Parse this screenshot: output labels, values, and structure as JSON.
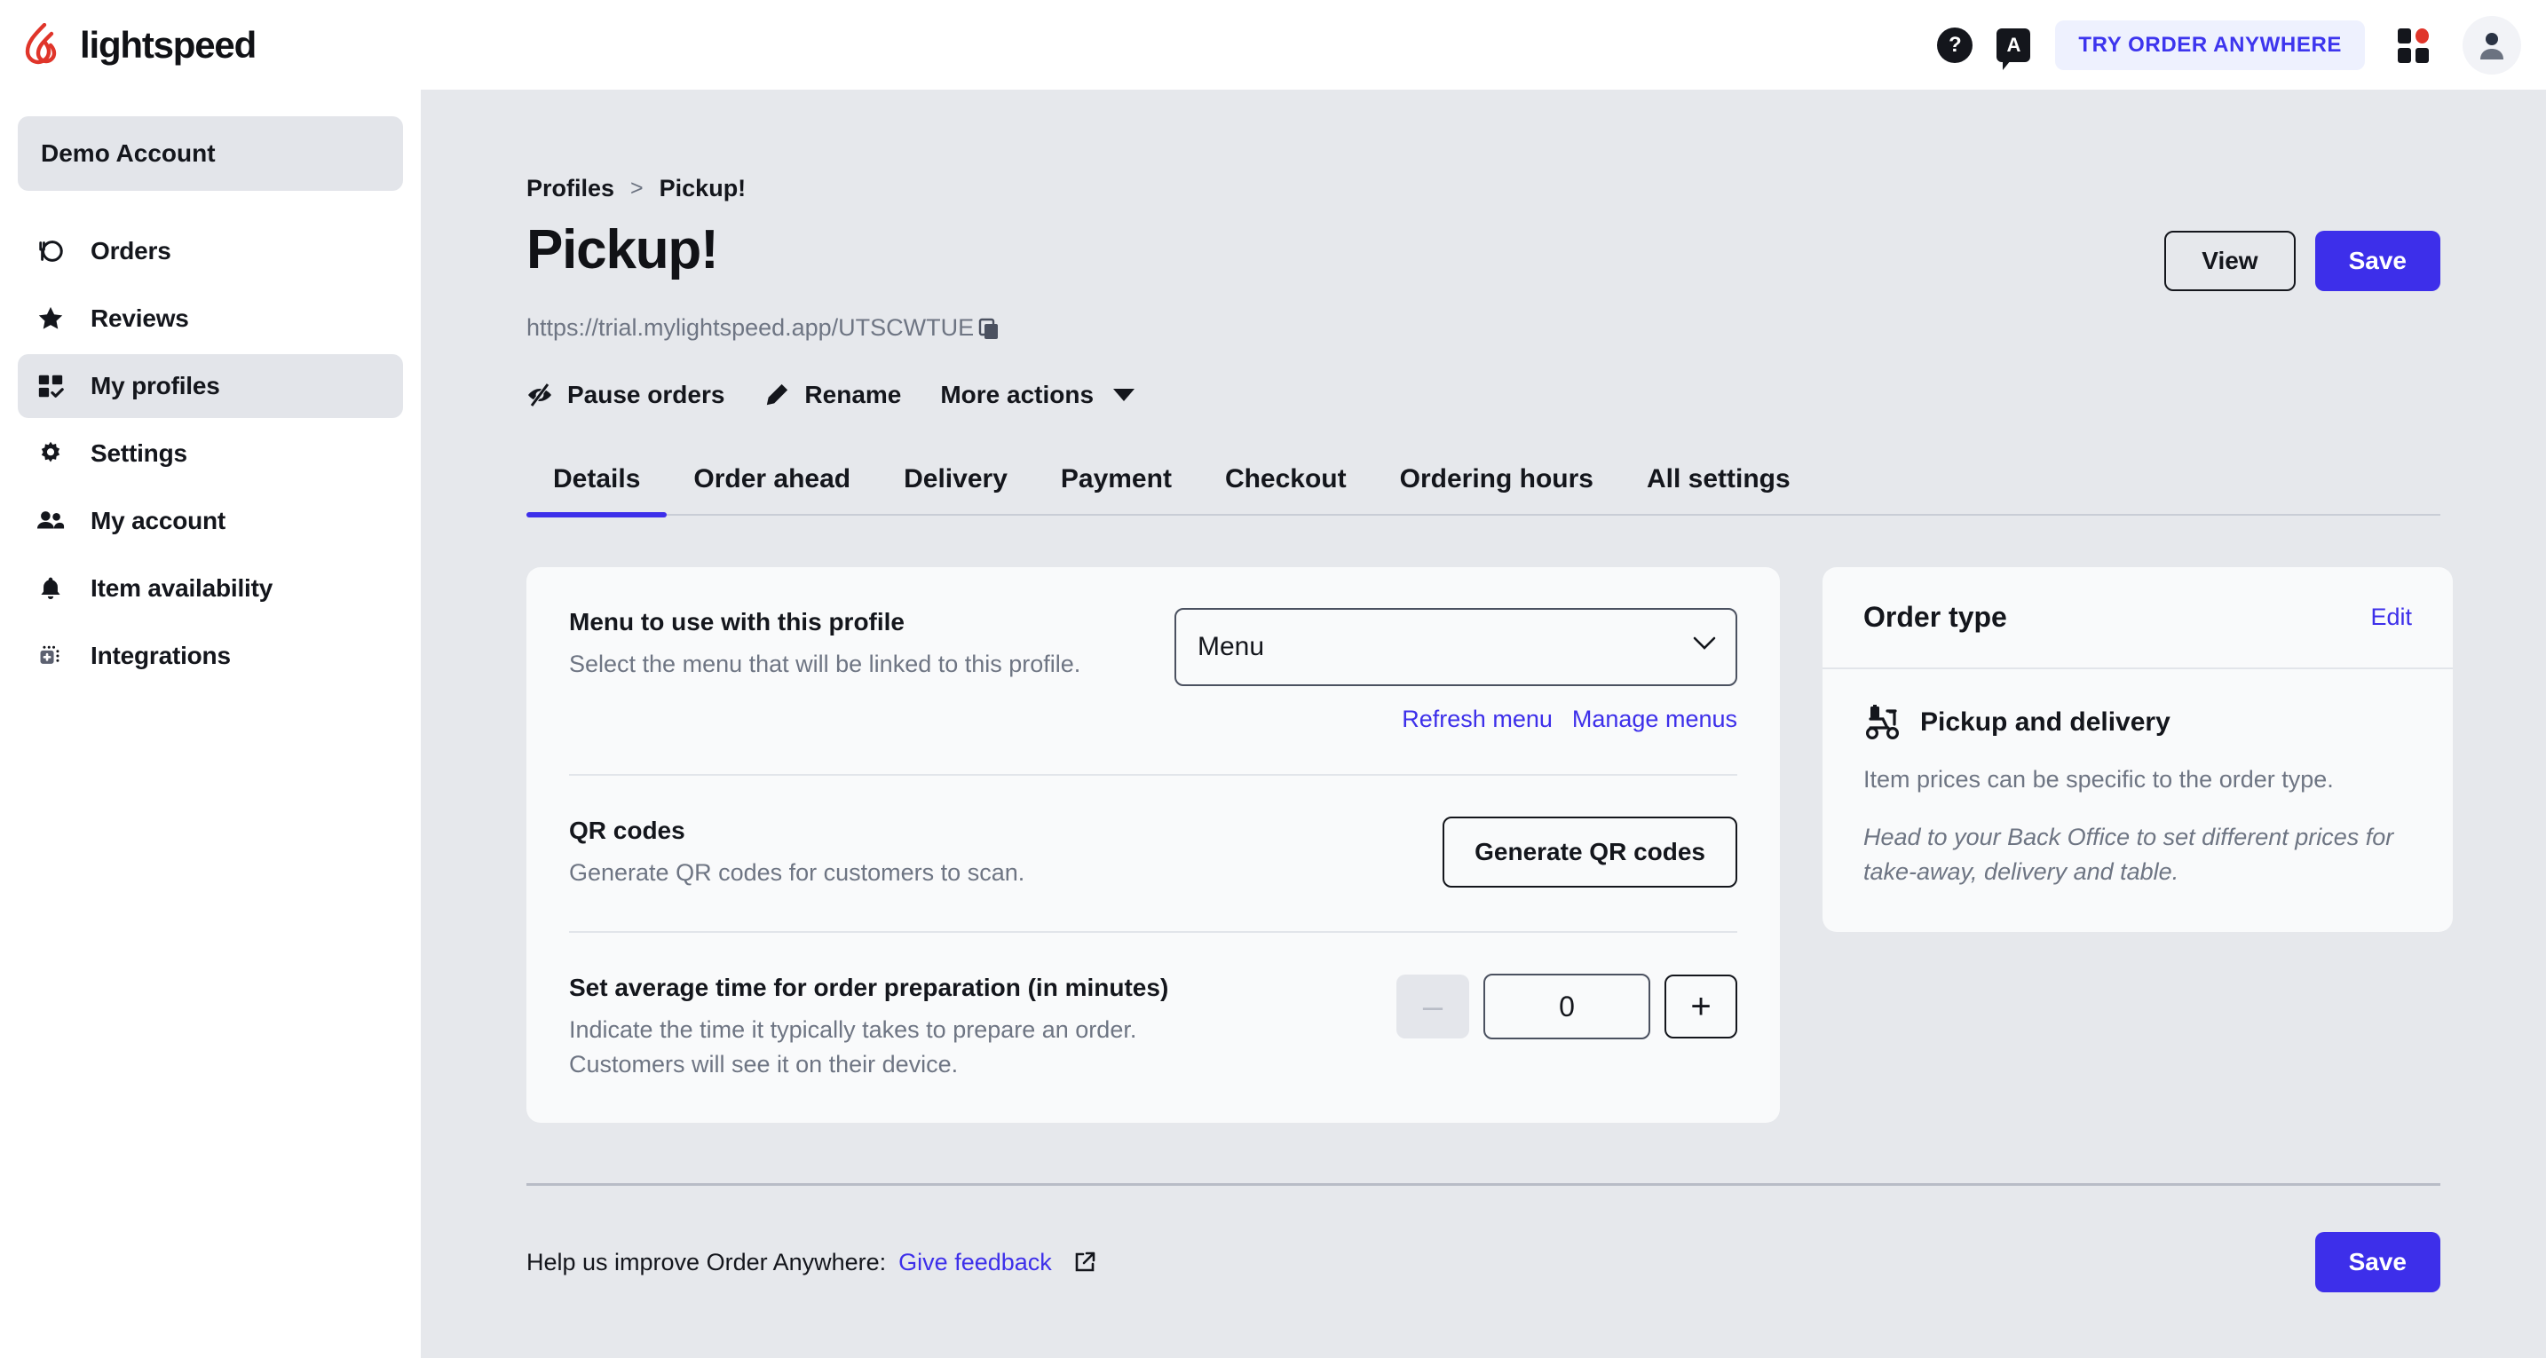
{
  "topbar": {
    "brand_name": "lightspeed",
    "brand_color": "#e0352a",
    "help_glyph": "?",
    "chat_glyph": "A",
    "try_button_label": "TRY ORDER ANYWHERE",
    "try_button_color": "#3d35ee"
  },
  "sidebar": {
    "account_label": "Demo Account",
    "items": [
      {
        "label": "Orders",
        "icon": "orders-icon",
        "active": false
      },
      {
        "label": "Reviews",
        "icon": "star-icon",
        "active": false
      },
      {
        "label": "My profiles",
        "icon": "profiles-grid-icon",
        "active": true
      },
      {
        "label": "Settings",
        "icon": "gear-icon",
        "active": false
      },
      {
        "label": "My account",
        "icon": "users-icon",
        "active": false
      },
      {
        "label": "Item availability",
        "icon": "bell-icon",
        "active": false
      },
      {
        "label": "Integrations",
        "icon": "integrations-icon",
        "active": false
      }
    ]
  },
  "breadcrumb": {
    "parent": "Profiles",
    "separator": ">",
    "current": "Pickup!"
  },
  "header": {
    "title": "Pickup!",
    "url": "https://trial.mylightspeed.app/UTSCWTUE",
    "view_label": "View",
    "save_label": "Save"
  },
  "actions": {
    "pause_orders": "Pause orders",
    "rename": "Rename",
    "more_actions": "More actions"
  },
  "tabs": [
    {
      "label": "Details",
      "active": true
    },
    {
      "label": "Order ahead",
      "active": false
    },
    {
      "label": "Delivery",
      "active": false
    },
    {
      "label": "Payment",
      "active": false
    },
    {
      "label": "Checkout",
      "active": false
    },
    {
      "label": "Ordering hours",
      "active": false
    },
    {
      "label": "All settings",
      "active": false
    }
  ],
  "details": {
    "menu_section": {
      "title": "Menu to use with this profile",
      "subtitle": "Select the menu that will be linked to this profile.",
      "selected_menu": "Menu",
      "refresh_link": "Refresh menu",
      "manage_link": "Manage menus"
    },
    "qr_section": {
      "title": "QR codes",
      "subtitle": "Generate QR codes for customers to scan.",
      "button_label": "Generate QR codes"
    },
    "prep_section": {
      "title": "Set average time for order preparation (in minutes)",
      "subtitle": "Indicate the time it typically takes to prepare an order. Customers will see it on their device.",
      "value": "0",
      "minus_label": "–",
      "plus_label": "+"
    }
  },
  "order_type_card": {
    "title": "Order type",
    "edit_label": "Edit",
    "type_label": "Pickup and delivery",
    "description": "Item prices can be specific to the order type.",
    "hint": "Head to your Back Office to set different prices for take-away, delivery and table."
  },
  "footer": {
    "text": "Help us improve Order Anywhere:",
    "link_label": "Give feedback",
    "save_label": "Save"
  },
  "colors": {
    "accent": "#3d2fea",
    "page_bg": "#e6e8ec",
    "card_bg": "#f9fafb",
    "brand_red": "#e0352a"
  }
}
